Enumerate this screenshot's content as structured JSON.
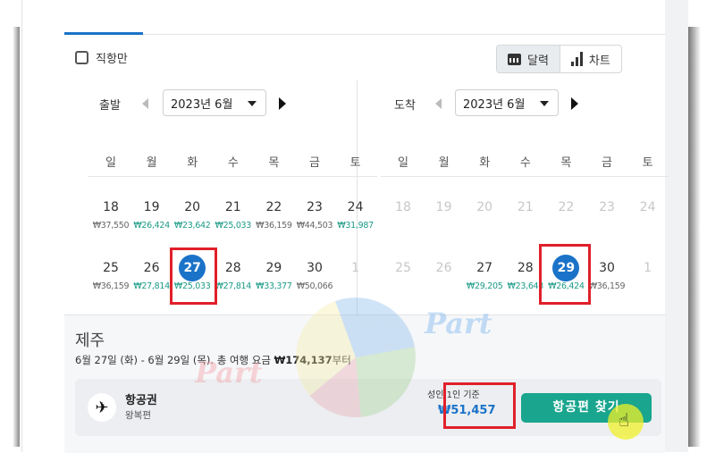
{
  "filters": {
    "direct_only_label": "직항만"
  },
  "view_toggle": {
    "calendar_label": "달력",
    "chart_label": "차트"
  },
  "departure": {
    "label": "출발",
    "month": "2023년 6월",
    "weekdays": [
      "일",
      "월",
      "화",
      "수",
      "목",
      "금",
      "토"
    ],
    "weeks": [
      [
        {
          "day": "18",
          "price": "₩37,550",
          "color": "gray"
        },
        {
          "day": "19",
          "price": "₩26,424",
          "color": "green"
        },
        {
          "day": "20",
          "price": "₩23,642",
          "color": "green"
        },
        {
          "day": "21",
          "price": "₩25,033",
          "color": "green"
        },
        {
          "day": "22",
          "price": "₩36,159",
          "color": "gray"
        },
        {
          "day": "23",
          "price": "₩44,503",
          "color": "gray"
        },
        {
          "day": "24",
          "price": "₩31,987",
          "color": "green"
        }
      ],
      [
        {
          "day": "25",
          "price": "₩36,159",
          "color": "gray"
        },
        {
          "day": "26",
          "price": "₩27,814",
          "color": "green"
        },
        {
          "day": "27",
          "price": "₩25,033",
          "color": "green",
          "selected": true
        },
        {
          "day": "28",
          "price": "₩27,814",
          "color": "green"
        },
        {
          "day": "29",
          "price": "₩33,377",
          "color": "green"
        },
        {
          "day": "30",
          "price": "₩50,066",
          "color": "gray"
        },
        {
          "day": "1",
          "price": "",
          "muted": true
        }
      ]
    ]
  },
  "arrival": {
    "label": "도착",
    "month": "2023년 6월",
    "weekdays": [
      "일",
      "월",
      "화",
      "수",
      "목",
      "금",
      "토"
    ],
    "weeks": [
      [
        {
          "day": "18",
          "price": "",
          "muted": true
        },
        {
          "day": "19",
          "price": "",
          "muted": true
        },
        {
          "day": "20",
          "price": "",
          "muted": true
        },
        {
          "day": "21",
          "price": "",
          "muted": true
        },
        {
          "day": "22",
          "price": "",
          "muted": true
        },
        {
          "day": "23",
          "price": "",
          "muted": true
        },
        {
          "day": "24",
          "price": "",
          "muted": true
        }
      ],
      [
        {
          "day": "25",
          "price": "",
          "muted": true
        },
        {
          "day": "26",
          "price": "",
          "muted": true
        },
        {
          "day": "27",
          "price": "₩29,205",
          "color": "green"
        },
        {
          "day": "28",
          "price": "₩23,643",
          "color": "green"
        },
        {
          "day": "29",
          "price": "₩26,424",
          "color": "green",
          "selected": true
        },
        {
          "day": "30",
          "price": "₩36,159",
          "color": "gray"
        },
        {
          "day": "1",
          "price": "",
          "muted": true
        }
      ]
    ]
  },
  "summary": {
    "destination": "제주",
    "range_prefix": "6월 27일 (화) - 6월 29일 (목). 총 여행 요금 ",
    "total": "₩174,137",
    "range_suffix": "부터"
  },
  "ticket": {
    "title": "항공권",
    "subtitle": "왕복편",
    "per_adult_label": "성인 1인 기준",
    "fare": "₩51,457",
    "search_button": "항공편 찾기"
  },
  "watermark": "Part",
  "colors": {
    "accent_blue": "#1a73c8",
    "price_green": "#1a9a86",
    "button_teal": "#19a58e",
    "highlight_red": "#e0202a"
  }
}
